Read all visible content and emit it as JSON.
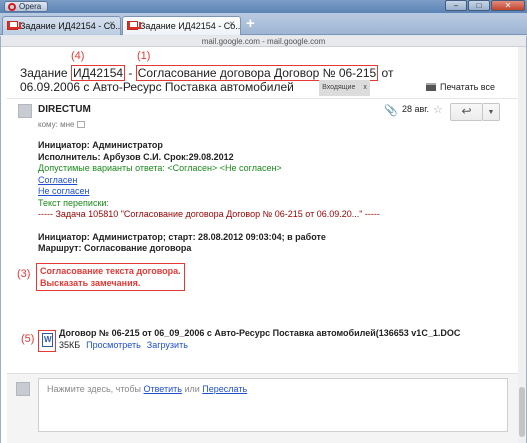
{
  "browser": {
    "app_name": "Opera",
    "window_buttons": [
      "–",
      "□",
      "✕"
    ],
    "tabs": [
      {
        "label": "Задание ИД42154 - Со..."
      },
      {
        "label": "Задание ИД42154 - Со..."
      }
    ],
    "new_tab": "+",
    "url": "mail.google.com - mail.google.com"
  },
  "message": {
    "subject_prefix": "Задание ",
    "task_id": "ИД42154",
    "subject_sep": " - ",
    "subject_title": "Согласование договора Договор № 06-215",
    "subject_suffix": " от",
    "subject_line2": "06.09.2006 с Авто-Ресурс Поставка автомобилей",
    "label_inbox": "Входящие",
    "label_close": "x",
    "annotation_4": "(4)",
    "annotation_1": "(1)",
    "print_all": "Печатать все"
  },
  "header": {
    "sender": "DIRECTUM",
    "to": "кому: мне",
    "date": "28 авг.",
    "reply_icon": "↩",
    "more_icon": "▼"
  },
  "body": {
    "initiator": "Инициатор: Администратор",
    "executor": "Исполнитель: Арбузов С.И. Срок:29.08.2012",
    "allowed": "Допустимые варианты ответа: <Согласен> <Не согласен>",
    "agree_link": "Согласен",
    "disagree_link": "Не согласен",
    "correspondence": "Текст переписки:",
    "thread": "----- Задача 105810 \"Согласование договора Договор № 06-215 от 06.09.20...\" -----",
    "initiator2": "Инициатор: Администратор; старт: 28.08.2012 09:03:04; в работе",
    "route": "Маршрут: Согласование договора",
    "annotation_3": "(3)",
    "remark_line1": "Согласование текста договора.",
    "remark_line2": "Высказать замечания."
  },
  "attachment": {
    "annotation_5": "(5)",
    "filename": "Договор № 06-215 от 06_09_2006 с Авто-Ресурс Поставка автомобилей(136653 v1C_1.DOC",
    "size": "35КБ",
    "view": "Просмотреть",
    "download": "Загрузить"
  },
  "reply": {
    "prompt_before": "Нажмите здесь, чтобы ",
    "reply_link": "Ответить",
    "or": " или ",
    "forward_link": "Переслать"
  }
}
